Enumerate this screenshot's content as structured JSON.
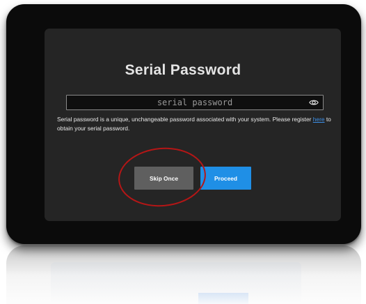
{
  "dialog": {
    "title": "Serial Password",
    "password_placeholder": "serial password",
    "description_part1": "Serial password is a unique, unchangeable password associated with your system. Please register ",
    "register_link": "here",
    "description_part2": " to obtain your serial password.",
    "skip_label": "Skip Once",
    "proceed_label": "Proceed"
  },
  "icons": {
    "show_password": "eye-icon"
  },
  "colors": {
    "dialog_bg": "#252525",
    "device_bg": "#0b0b0b",
    "skip_bg": "#5f5f5f",
    "proceed_bg": "#1f8fe6",
    "link": "#3d8fe6",
    "annotation": "#b51616"
  }
}
